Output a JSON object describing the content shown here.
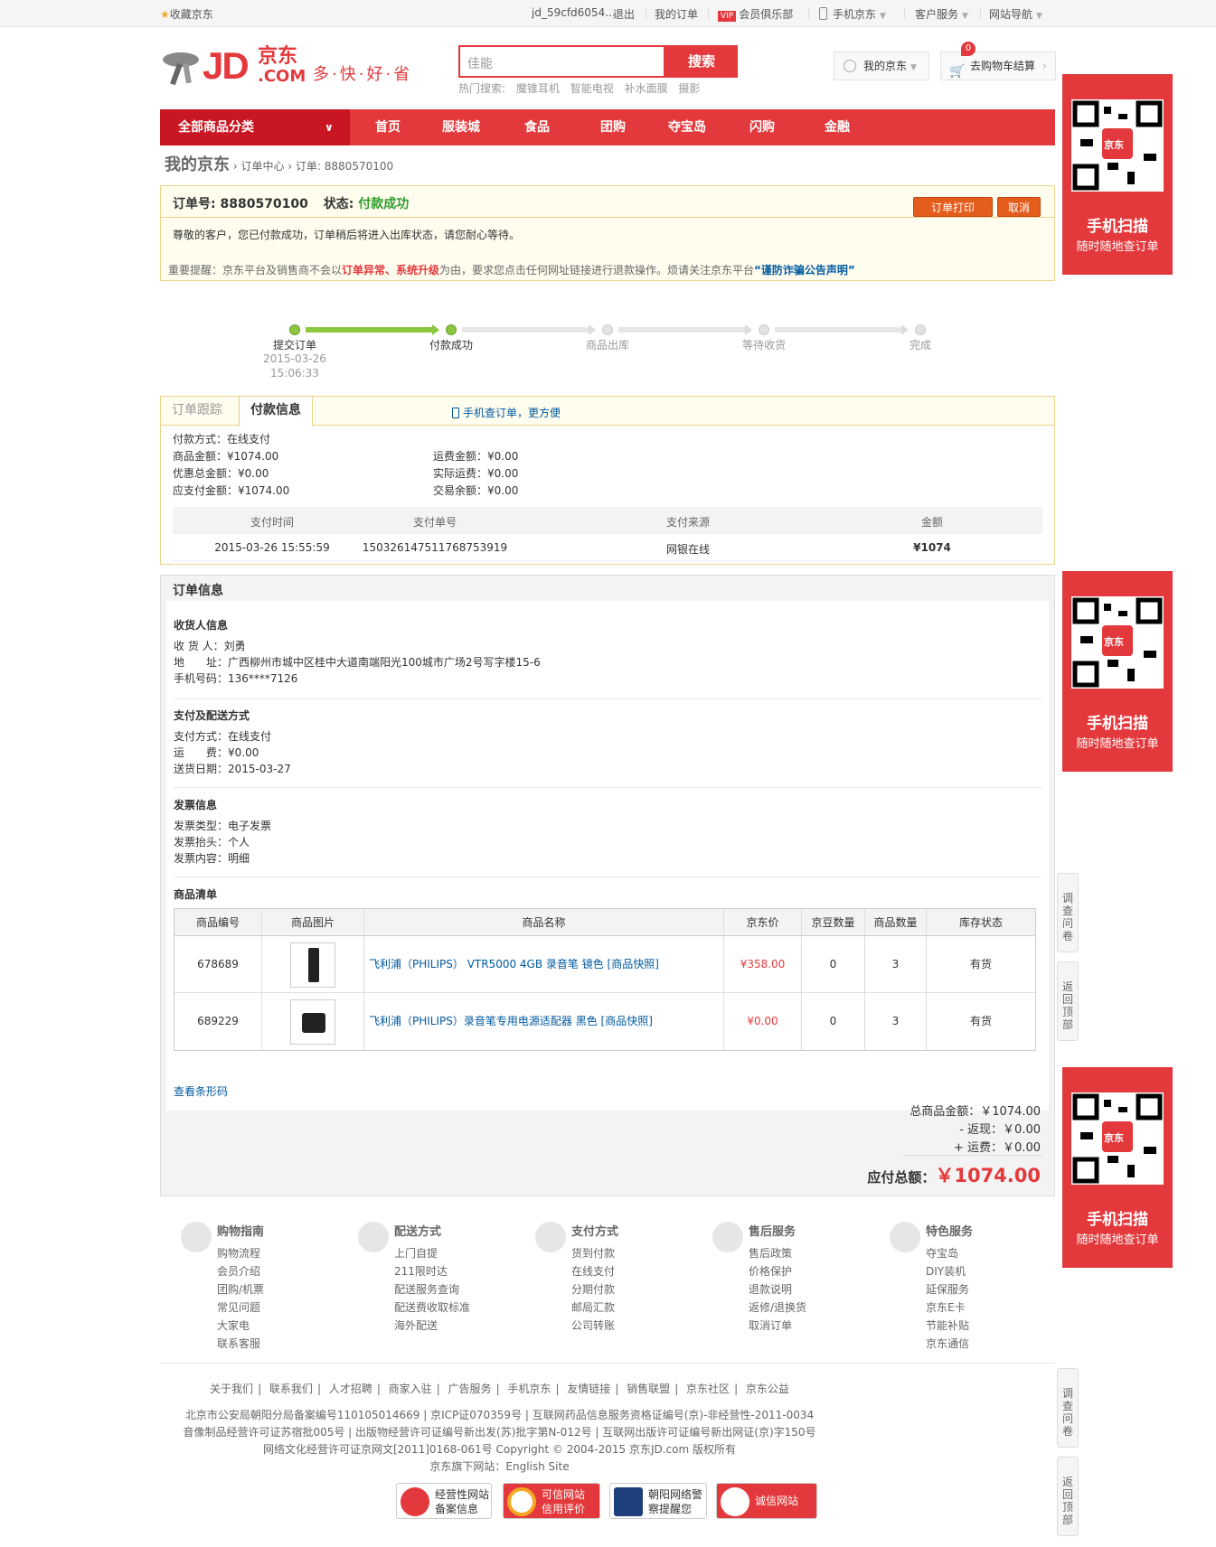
{
  "topbar": {
    "favorite": "收藏京东",
    "user": "jd_59cfd6054...",
    "logout": "退出",
    "my_orders": "我的订单",
    "vip_badge": "VIP",
    "vip_club": "会员俱乐部",
    "mobile_jd": "手机京东",
    "customer_service": "客户服务",
    "site_nav": "网站导航"
  },
  "header": {
    "logo_jd": "JD",
    "logo_cn": "京东",
    "logo_com": ".COM",
    "slogan": "多·快·好·省",
    "search_placeholder": "佳能",
    "search_button": "搜索",
    "hot_label": "热门搜索:",
    "hot_terms": [
      "魔锥耳机",
      "智能电视",
      "补水面膜",
      "摄影"
    ],
    "my_jd": "我的京东",
    "cart": "去购物车结算",
    "cart_count": "0"
  },
  "nav": {
    "all_categories": "全部商品分类",
    "items": [
      "首页",
      "服装城",
      "食品",
      "团购",
      "夺宝岛",
      "闪购",
      "金融"
    ]
  },
  "breadcrumb": {
    "home": "我的京东",
    "center": "订单中心",
    "order": "订单: 8880570100"
  },
  "order": {
    "number_label": "订单号:",
    "number": "8880570100",
    "status_label": "状态:",
    "status": "付款成功",
    "print_btn": "订单打印",
    "cancel_btn": "取消",
    "message": "尊敬的客户，您已付款成功，订单稍后将进入出库状态，请您耐心等待。"
  },
  "notice": {
    "prefix": "重要提醒：京东平台及销售商不会以",
    "red": "订单异常、系统升级",
    "middle": "为由，要求您点击任何网址链接进行退款操作。烦请关注京东平台",
    "link": "“谨防诈骗公告声明”"
  },
  "progress": {
    "steps": [
      {
        "label": "提交订单",
        "date": "2015-03-26",
        "time": "15:06:33"
      },
      {
        "label": "付款成功"
      },
      {
        "label": "商品出库"
      },
      {
        "label": "等待收货"
      },
      {
        "label": "完成"
      }
    ]
  },
  "payinfo": {
    "tab_track": "订单跟踪",
    "tab_pay": "付款信息",
    "mobile_link": "手机查订单，更方便",
    "method": "付款方式：在线支付",
    "goods_amount": "商品金额：¥1074.00",
    "discount": "优惠总金额：¥0.00",
    "payable": "应支付金额：¥1074.00",
    "freight": "运费金额：¥0.00",
    "actual_freight": "实际运费：¥0.00",
    "balance": "交易余额：¥0.00",
    "table_headers": [
      "支付时间",
      "支付单号",
      "支付来源",
      "金额"
    ],
    "table_row": [
      "2015-03-26 15:55:59",
      "150326147511768753919",
      "网银在线",
      "¥1074"
    ]
  },
  "info": {
    "title": "订单信息",
    "receiver_title": "收货人信息",
    "receiver": "收 货 人：刘勇",
    "address": "地　　址：广西柳州市城中区桂中大道南端阳光100城市广场2号写字楼15-6",
    "phone": "手机号码：136****7126",
    "delivery_title": "支付及配送方式",
    "pay_method": "支付方式：在线支付",
    "freight": "运　　费：¥0.00",
    "delivery_date": "送货日期：2015-03-27",
    "invoice_title": "发票信息",
    "invoice_type": "发票类型：电子发票",
    "invoice_head": "发票抬头：个人",
    "invoice_content": "发票内容：明细",
    "goods_title": "商品清单",
    "goods_headers": [
      "商品编号",
      "商品图片",
      "商品名称",
      "京东价",
      "京豆数量",
      "商品数量",
      "库存状态"
    ],
    "goods": [
      {
        "id": "678689",
        "name": "飞利浦（PHILIPS） VTR5000 4GB 录音笔 镜色 [商品快照]",
        "price": "¥358.00",
        "beans": "0",
        "qty": "3",
        "stock": "有货"
      },
      {
        "id": "689229",
        "name": "飞利浦（PHILIPS）录音笔专用电源适配器 黑色 [商品快照]",
        "price": "¥0.00",
        "beans": "0",
        "qty": "3",
        "stock": "有货"
      }
    ],
    "barcode_link": "查看条形码",
    "total_goods": "总商品金额：￥1074.00",
    "rebate": "- 返现：￥0.00",
    "shipping": "+ 运费：￥0.00",
    "payable_label": "应付总额：",
    "payable_value": "￥1074.00"
  },
  "footer": {
    "cols": [
      {
        "title": "购物指南",
        "links": [
          "购物流程",
          "会员介绍",
          "团购/机票",
          "常见问题",
          "大家电",
          "联系客服"
        ]
      },
      {
        "title": "配送方式",
        "links": [
          "上门自提",
          "211限时达",
          "配送服务查询",
          "配送费收取标准",
          "海外配送"
        ]
      },
      {
        "title": "支付方式",
        "links": [
          "货到付款",
          "在线支付",
          "分期付款",
          "邮局汇款",
          "公司转账"
        ]
      },
      {
        "title": "售后服务",
        "links": [
          "售后政策",
          "价格保护",
          "退款说明",
          "返修/退换货",
          "取消订单"
        ]
      },
      {
        "title": "特色服务",
        "links": [
          "夺宝岛",
          "DIY装机",
          "延保服务",
          "京东E卡",
          "节能补贴",
          "京东通信"
        ]
      }
    ],
    "links": [
      "关于我们",
      "联系我们",
      "人才招聘",
      "商家入驻",
      "广告服务",
      "手机京东",
      "友情链接",
      "销售联盟",
      "京东社区",
      "京东公益"
    ],
    "copy1": "北京市公安局朝阳分局备案编号110105014669 | 京ICP证070359号 | 互联网药品信息服务资格证编号(京)-非经营性-2011-0034",
    "copy2": "音像制品经营许可证苏宿批005号 | 出版物经营许可证编号新出发(苏)批字第N-012号 | 互联网出版许可证编号新出网证(京)字150号",
    "copy3": "网络文化经营许可证京网文[2011]0168-061号 Copyright © 2004-2015 京东JD.com 版权所有",
    "copy4": "京东旗下网站：English Site",
    "badges": [
      {
        "l1": "经营性网站",
        "l2": "备案信息"
      },
      {
        "l1": "可信网站",
        "l2": "信用评价"
      },
      {
        "l1": "朝阳网络警",
        "l2": "察提醒您"
      },
      {
        "l1": "诚信网站",
        "l2": ""
      }
    ]
  },
  "side": {
    "qr_badge": "京东",
    "qr_title": "手机扫描",
    "qr_sub": "随时随地查订单",
    "survey": "调查问卷",
    "top": "返回顶部"
  },
  "colors": {
    "brand": "#e4393c",
    "success": "#2c9d2c",
    "link": "#005aa0"
  }
}
